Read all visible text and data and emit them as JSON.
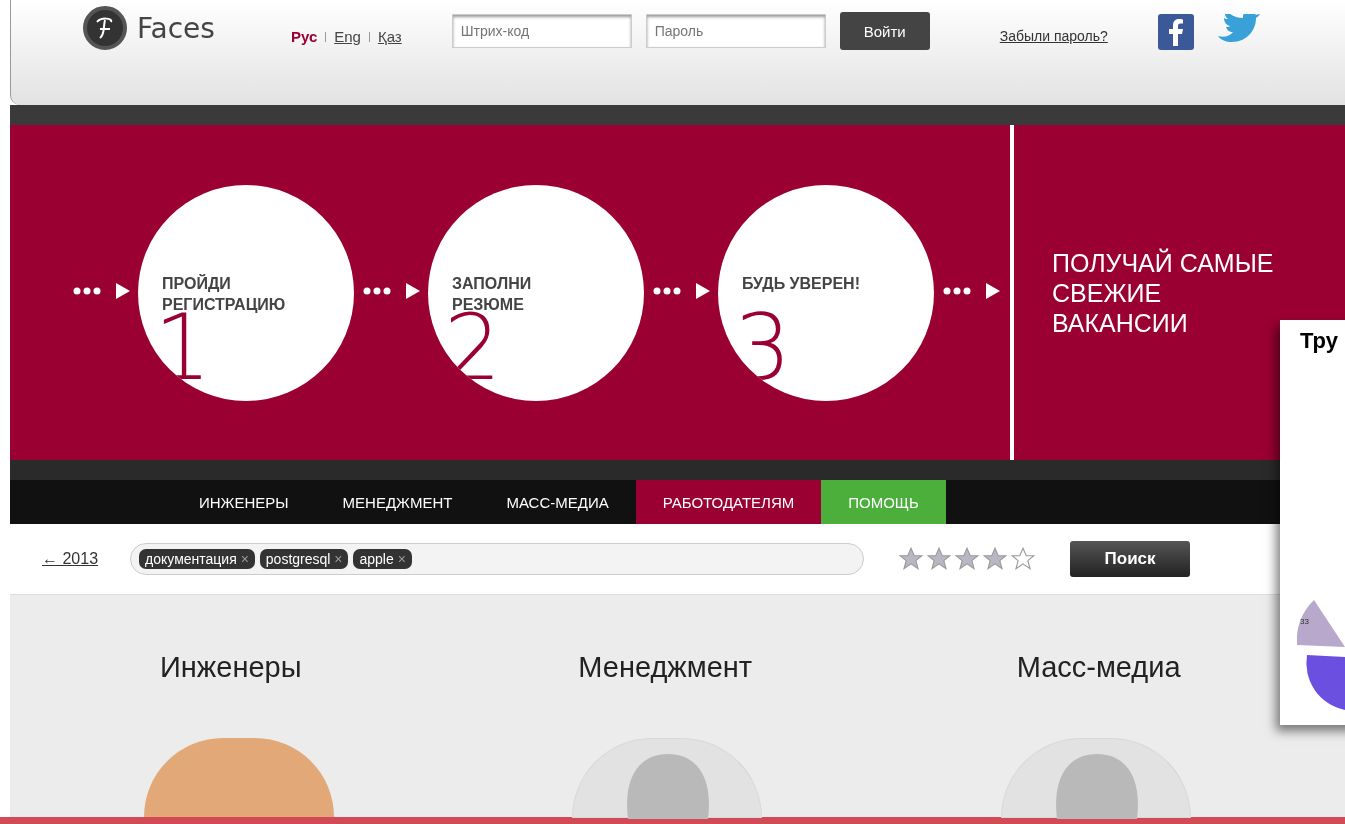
{
  "header": {
    "logo_text": "Faces",
    "languages": [
      {
        "label": "Рус",
        "selected": true
      },
      {
        "label": "Eng",
        "selected": false
      },
      {
        "label": "Қаз",
        "selected": false
      }
    ],
    "barcode_field": {
      "placeholder": "Штрих-код"
    },
    "password_field": {
      "placeholder": "Пароль"
    },
    "login_button": "Войти",
    "forgot_link": "Забыли пароль?"
  },
  "banner": {
    "steps": [
      {
        "title": "ПРОЙДИ РЕГИСТРАЦИЮ",
        "number": "1"
      },
      {
        "title": "ЗАПОЛНИ РЕЗЮМЕ",
        "number": "2"
      },
      {
        "title": "БУДЬ УВЕРЕН!",
        "number": "3"
      }
    ],
    "slogan": "ПОЛУЧАЙ САМЫЕ СВЕЖИЕ ВАКАНСИИ"
  },
  "nav": [
    {
      "label": "ИНЖЕНЕРЫ",
      "color": "#111111"
    },
    {
      "label": "МЕНЕДЖМЕНТ",
      "color": "#111111"
    },
    {
      "label": "МАСС-МЕДИА",
      "color": "#111111"
    },
    {
      "label": "РАБОТОДАТЕЛЯМ",
      "color": "#9a0032"
    },
    {
      "label": "ПОМОЩЬ",
      "color": "#4caf3c"
    }
  ],
  "search": {
    "back_link": "← 2013",
    "tags": [
      {
        "label": "документация",
        "remove": "×"
      },
      {
        "label": "postgresql",
        "remove": "×"
      },
      {
        "label": "apple",
        "remove": "×"
      }
    ],
    "stars": 4,
    "button": "Поиск"
  },
  "columns": [
    {
      "title": "Инженеры",
      "kind": "photo"
    },
    {
      "title": "Менеджмент",
      "kind": "silhouette"
    },
    {
      "title": "Масс-медиа",
      "kind": "silhouette"
    }
  ],
  "popup": {
    "title": "Тру",
    "pie_label": "33"
  }
}
